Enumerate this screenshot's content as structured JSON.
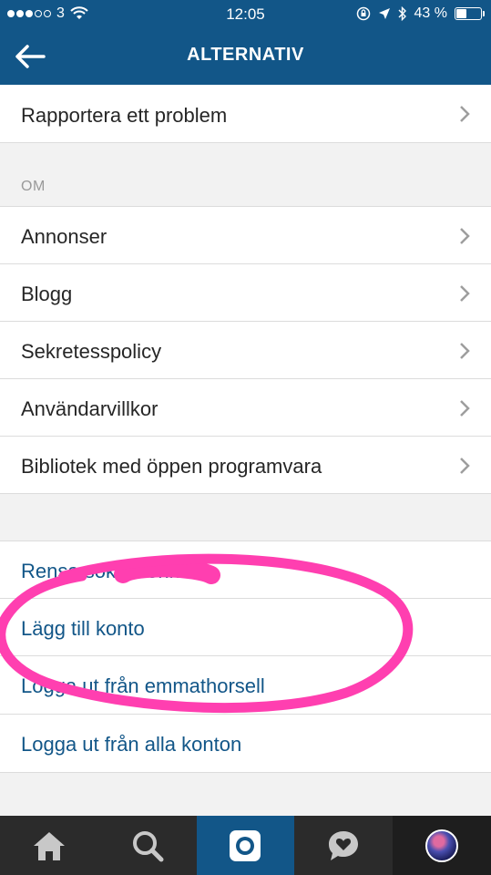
{
  "status_bar": {
    "carrier": "3",
    "time": "12:05",
    "battery": "43 %",
    "battery_level": 0.43
  },
  "nav": {
    "title": "ALTERNATIV"
  },
  "rows_top": [
    {
      "label": "Rapportera ett problem"
    }
  ],
  "about": {
    "header": "OM",
    "items": [
      {
        "label": "Annonser"
      },
      {
        "label": "Blogg"
      },
      {
        "label": "Sekretesspolicy"
      },
      {
        "label": "Användarvillkor"
      },
      {
        "label": "Bibliotek med öppen programvara"
      }
    ]
  },
  "account": {
    "items": [
      {
        "label": "Rensa sökhistorik"
      },
      {
        "label": "Lägg till konto"
      },
      {
        "label": "Logga ut från emmathorsell"
      },
      {
        "label": "Logga ut från alla konton"
      }
    ]
  },
  "colors": {
    "brand": "#125688",
    "highlight": "#ff3fb0"
  },
  "tabbar": {
    "tabs": [
      {
        "icon": "home-icon"
      },
      {
        "icon": "search-icon"
      },
      {
        "icon": "camera-icon"
      },
      {
        "icon": "activity-icon"
      },
      {
        "icon": "profile-avatar"
      }
    ]
  }
}
